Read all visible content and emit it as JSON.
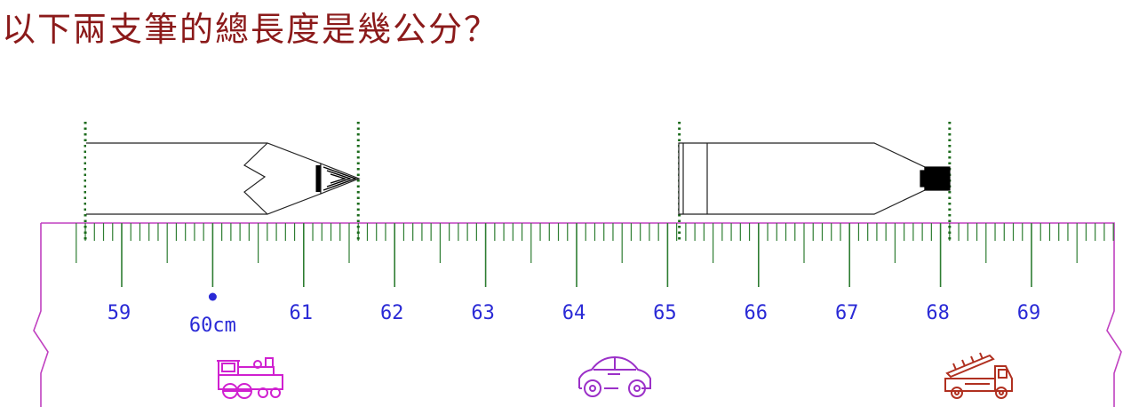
{
  "question": "以下兩支筆的總長度是幾公分？",
  "ruler": {
    "labels": [
      "59",
      "60cm",
      "61",
      "62",
      "63",
      "64",
      "65",
      "66",
      "67",
      "68",
      "69"
    ],
    "start_cm": 58.5,
    "end_cm": 69.9,
    "highlight_cm": 60
  },
  "pencil_1": {
    "start_cm": 58.6,
    "end_cm": 61.6
  },
  "pencil_2": {
    "start_cm": 65.1,
    "end_cm": 68.1
  },
  "icons": [
    "train-icon",
    "car-icon",
    "fire-truck-icon"
  ],
  "colors": {
    "title": "#8B1A1A",
    "ruler_outline": "#c040c0",
    "ticks": "#2e7d32",
    "numbers": "#2a2ad6",
    "guides": "#1b6b1b",
    "train": "#d020d0",
    "car": "#9b30c8",
    "fire_truck": "#b03020"
  }
}
